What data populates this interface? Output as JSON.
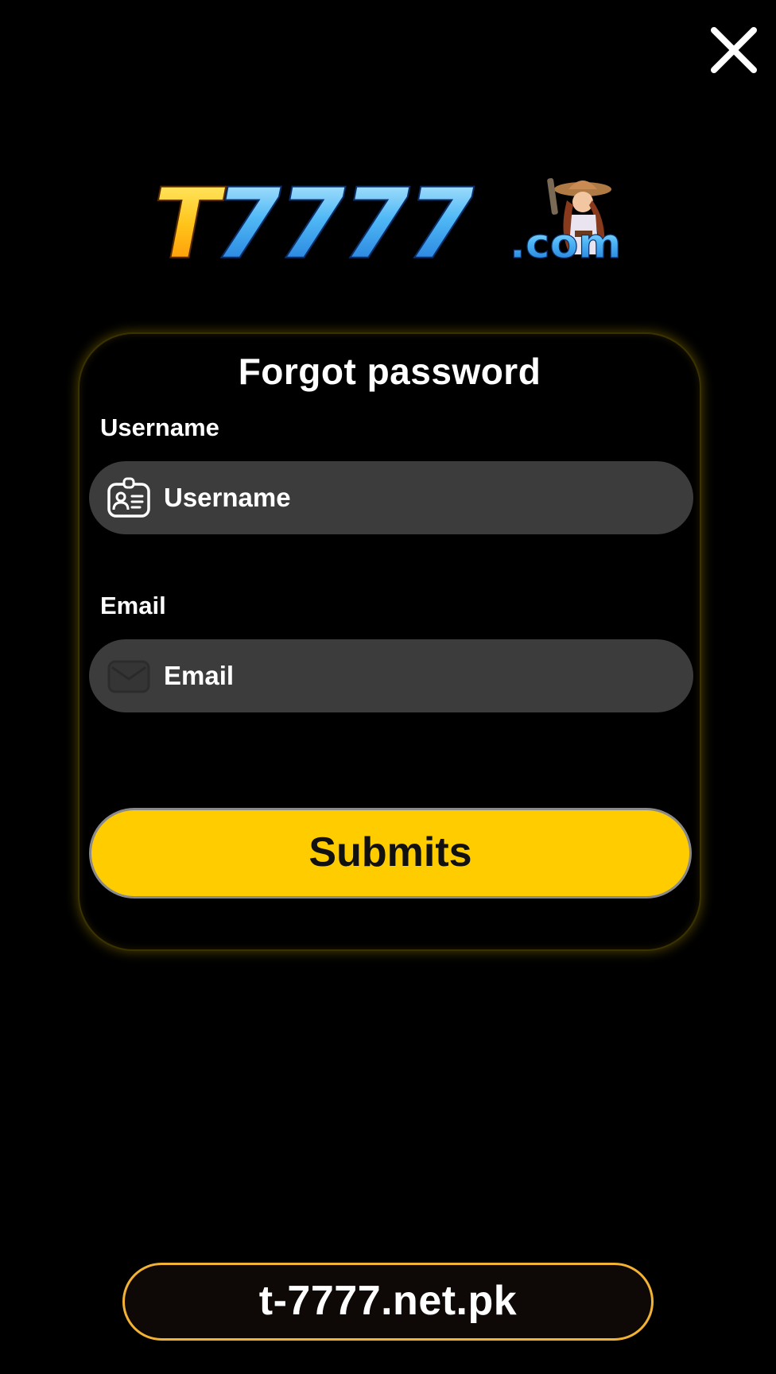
{
  "logo": {
    "text_t": "T",
    "text_digits": "7777",
    "text_suffix": ".com"
  },
  "dialog": {
    "title": "Forgot password",
    "username": {
      "label": "Username",
      "placeholder": "Username",
      "value": "",
      "icon": "id-card-icon"
    },
    "email": {
      "label": "Email",
      "placeholder": "Email",
      "value": "",
      "icon": "envelope-icon"
    },
    "submit_label": "Submits"
  },
  "footer": {
    "domain": "t-7777.net.pk"
  },
  "colors": {
    "background": "#000000",
    "accent_yellow": "#ffcc00",
    "input_bg": "#3c3c3c",
    "footer_border": "#f2b233",
    "logo_blue": "#4fb8f5",
    "logo_gold": "#ffc41a"
  },
  "icons": {
    "close": "close-icon"
  }
}
